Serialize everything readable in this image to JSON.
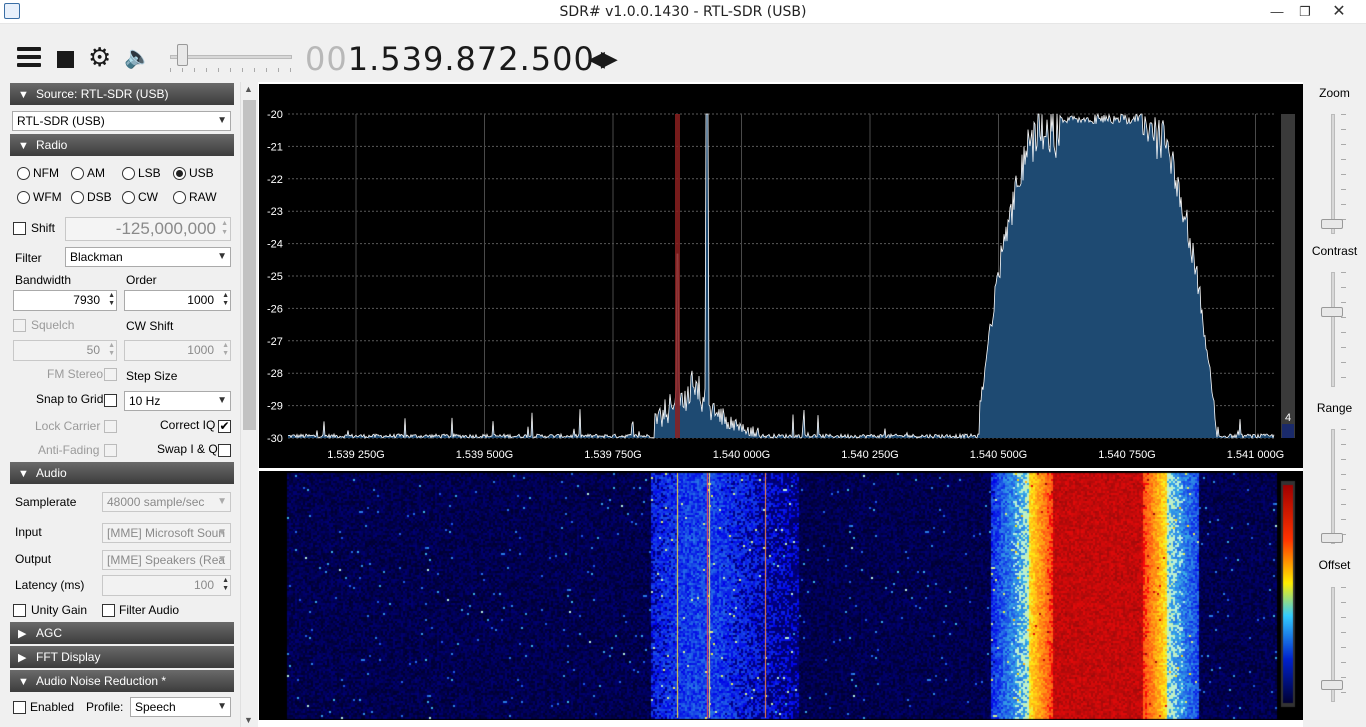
{
  "window": {
    "title": "SDR# v1.0.0.1430 - RTL-SDR (USB)"
  },
  "toolbar": {
    "frequency_prefix": "00",
    "frequency_main": "1.539.872.500",
    "frequency_arrows": "◀▶",
    "volume_level": 0.12
  },
  "source": {
    "header": "Source: RTL-SDR (USB)",
    "device": "RTL-SDR (USB)"
  },
  "radio": {
    "header": "Radio",
    "modes": [
      "NFM",
      "AM",
      "LSB",
      "USB",
      "WFM",
      "DSB",
      "CW",
      "RAW"
    ],
    "selected_mode": "USB",
    "shift_label": "Shift",
    "shift_value": "-125,000,000",
    "filter_label": "Filter",
    "filter_value": "Blackman",
    "bandwidth_label": "Bandwidth",
    "bandwidth_value": "7930",
    "order_label": "Order",
    "order_value": "1000",
    "squelch_label": "Squelch",
    "squelch_value": "50",
    "cwshift_label": "CW Shift",
    "cwshift_value": "1000",
    "fmstereo_label": "FM Stereo",
    "stepsize_label": "Step Size",
    "snap_label": "Snap to Grid",
    "stepsize_value": "10 Hz",
    "lockcarrier_label": "Lock Carrier",
    "correctiq_label": "Correct IQ",
    "antifading_label": "Anti-Fading",
    "swapiq_label": "Swap I & Q"
  },
  "audio": {
    "header": "Audio",
    "samplerate_label": "Samplerate",
    "samplerate_value": "48000 sample/sec",
    "input_label": "Input",
    "input_value": "[MME] Microsoft Soun",
    "output_label": "Output",
    "output_value": "[MME] Speakers (Rea",
    "latency_label": "Latency (ms)",
    "latency_value": "100",
    "unity_label": "Unity Gain",
    "filter_audio_label": "Filter Audio"
  },
  "collapsed": {
    "agc": "AGC",
    "fft": "FFT Display"
  },
  "noise": {
    "header": "Audio Noise Reduction *",
    "enabled_label": "Enabled",
    "profile_label": "Profile:",
    "profile_value": "Speech"
  },
  "spectrum": {
    "y_labels": [
      "-20",
      "-21",
      "-22",
      "-23",
      "-24",
      "-25",
      "-26",
      "-27",
      "-28",
      "-29",
      "-30"
    ],
    "x_labels": [
      "1.539 250G",
      "1.539 500G",
      "1.539 750G",
      "1.540 000G",
      "1.540 250G",
      "1.540 500G",
      "1.540 750G",
      "1.541 000G"
    ],
    "scale_value": "4",
    "fill_color": "#1e4a72",
    "trace_color": "#ffffff",
    "tuning_color": "#8b2020"
  },
  "right": {
    "zoom_label": "Zoom",
    "contrast_label": "Contrast",
    "range_label": "Range",
    "offset_label": "Offset"
  }
}
